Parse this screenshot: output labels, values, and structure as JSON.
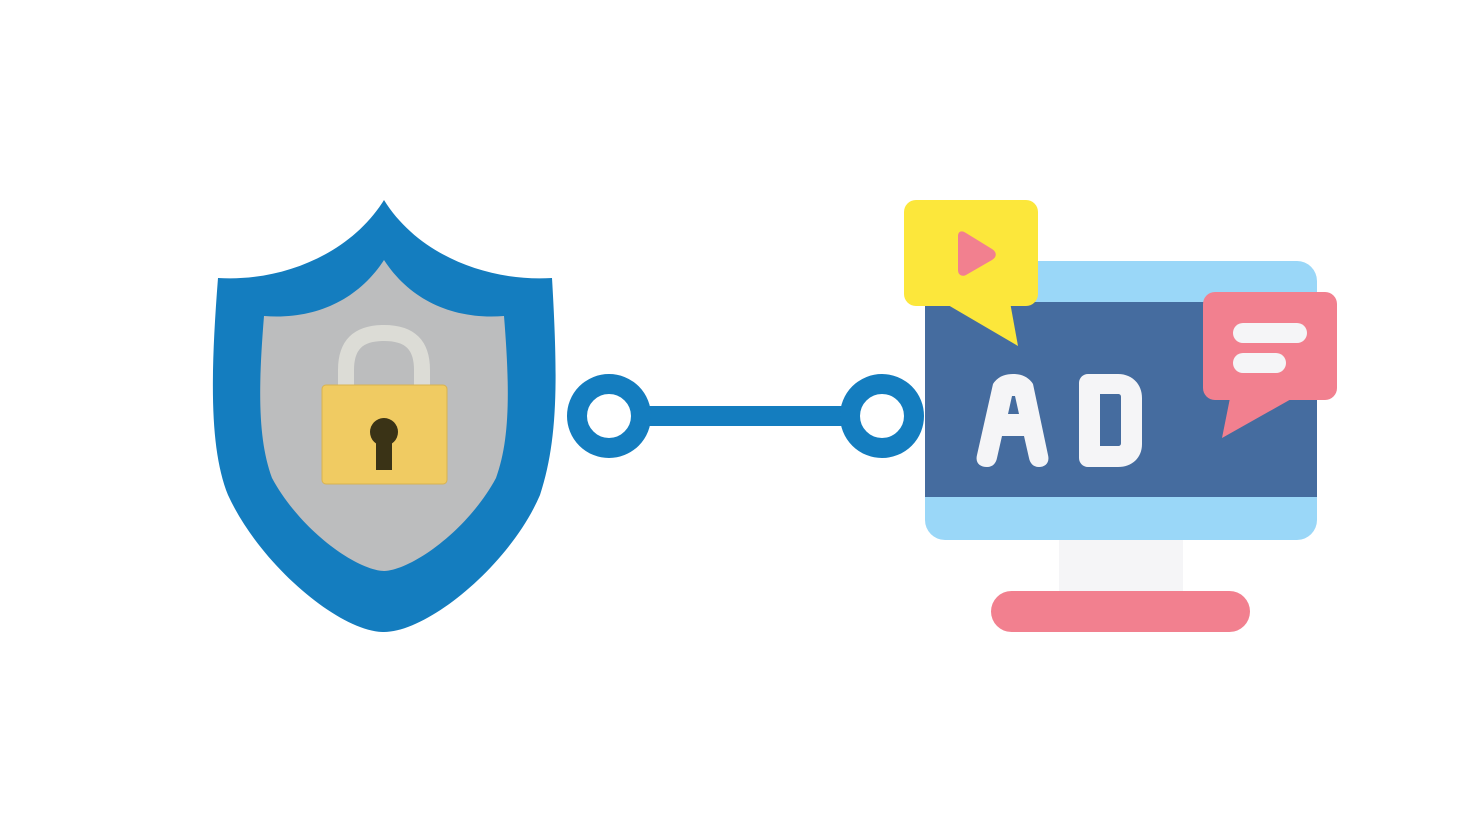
{
  "ad_screen": {
    "text": "AD"
  },
  "colors": {
    "background": "#ffffff",
    "shield_outer": "#147dbf",
    "shield_inner": "#bcbdbe",
    "padlock_body": "#f0cb62",
    "padlock_shackle": "#dcdcd6",
    "keyhole": "#3a3316",
    "connector": "#147dbf",
    "monitor_frame": "#9ad7f8",
    "monitor_screen": "#456c9f",
    "monitor_neck": "#f5f5f7",
    "monitor_base": "#f2808f",
    "ad_text": "#f5f5f7",
    "video_bubble": "#fce73b",
    "play_icon": "#f2808f",
    "chat_bubble": "#f2808f",
    "chat_lines": "#f5f5f7"
  },
  "icons": [
    "shield-icon",
    "padlock-icon",
    "connector-line",
    "monitor-icon",
    "video-bubble-icon",
    "play-icon",
    "chat-bubble-icon"
  ]
}
